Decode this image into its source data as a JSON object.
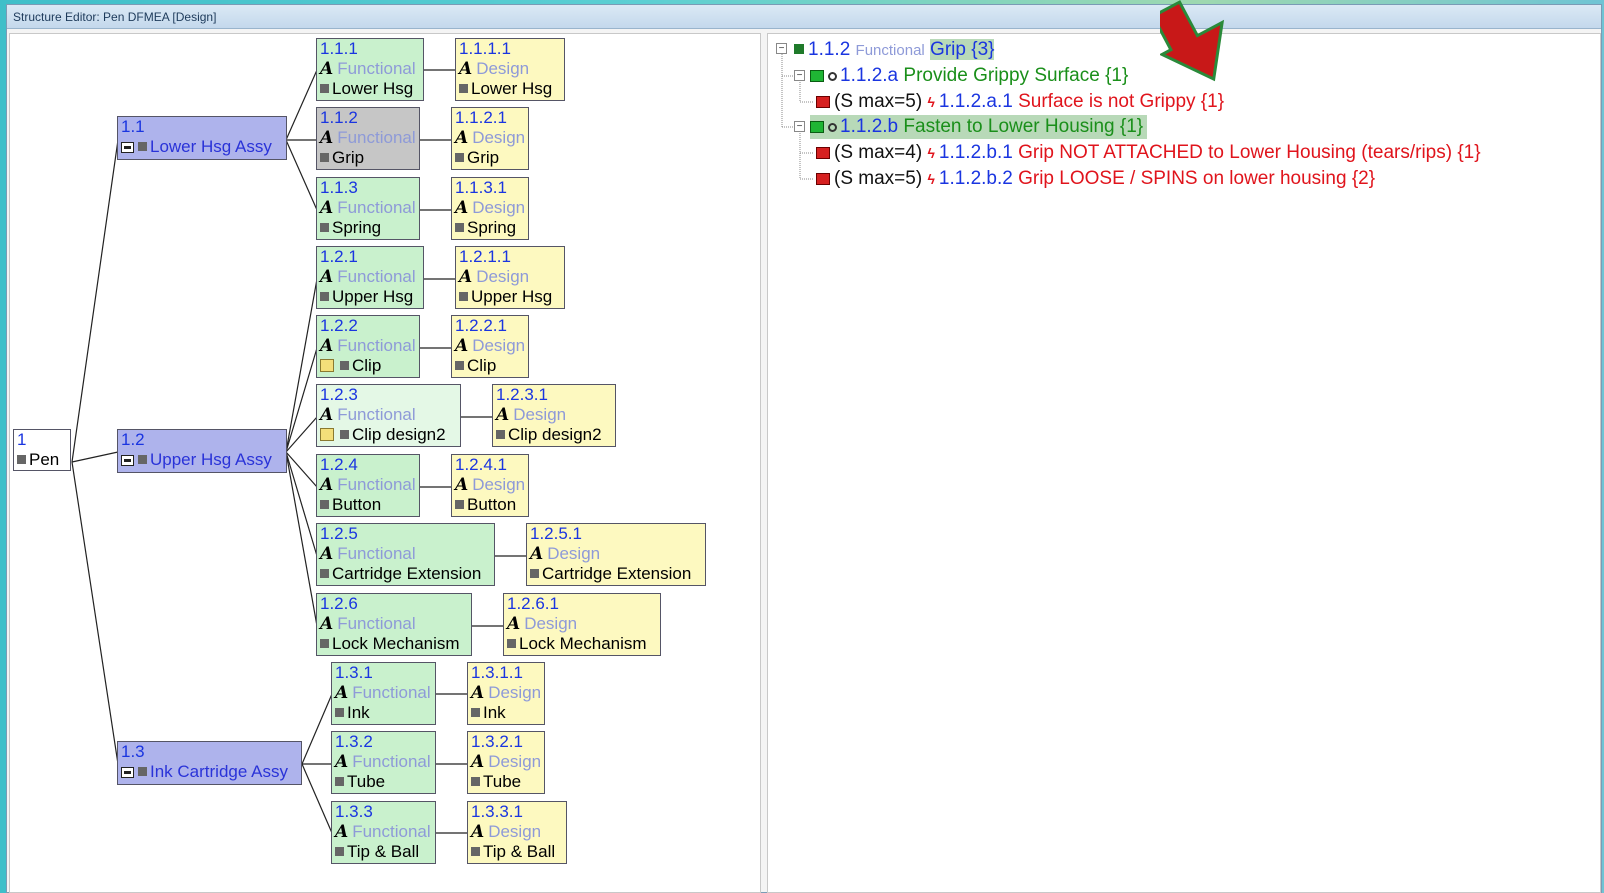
{
  "window": {
    "title": "Structure Editor: Pen DFMEA [Design]"
  },
  "left_tree": {
    "root": {
      "num": "1",
      "label": "Pen"
    },
    "assy": [
      {
        "num": "1.1",
        "label": "Lower Hsg Assy"
      },
      {
        "num": "1.2",
        "label": "Upper Hsg Assy"
      },
      {
        "num": "1.3",
        "label": "Ink Cartridge Assy"
      }
    ],
    "functional_kind": "Functional",
    "design_kind": "Design",
    "functional": [
      {
        "num": "1.1.1",
        "label": "Lower Hsg"
      },
      {
        "num": "1.1.2",
        "label": "Grip"
      },
      {
        "num": "1.1.3",
        "label": "Spring"
      },
      {
        "num": "1.2.1",
        "label": "Upper Hsg"
      },
      {
        "num": "1.2.2",
        "label": "Clip"
      },
      {
        "num": "1.2.3",
        "label": "Clip design2"
      },
      {
        "num": "1.2.4",
        "label": "Button"
      },
      {
        "num": "1.2.5",
        "label": "Cartridge Extension"
      },
      {
        "num": "1.2.6",
        "label": "Lock Mechanism"
      },
      {
        "num": "1.3.1",
        "label": "Ink"
      },
      {
        "num": "1.3.2",
        "label": "Tube"
      },
      {
        "num": "1.3.3",
        "label": "Tip & Ball"
      }
    ],
    "design": [
      {
        "num": "1.1.1.1",
        "label": "Lower Hsg"
      },
      {
        "num": "1.1.2.1",
        "label": "Grip"
      },
      {
        "num": "1.1.3.1",
        "label": "Spring"
      },
      {
        "num": "1.2.1.1",
        "label": "Upper Hsg"
      },
      {
        "num": "1.2.2.1",
        "label": "Clip"
      },
      {
        "num": "1.2.3.1",
        "label": "Clip design2"
      },
      {
        "num": "1.2.4.1",
        "label": "Button"
      },
      {
        "num": "1.2.5.1",
        "label": "Cartridge Extension"
      },
      {
        "num": "1.2.6.1",
        "label": "Lock Mechanism"
      },
      {
        "num": "1.3.1.1",
        "label": "Ink"
      },
      {
        "num": "1.3.2.1",
        "label": "Tube"
      },
      {
        "num": "1.3.3.1",
        "label": "Tip & Ball"
      }
    ]
  },
  "right_tree": {
    "root": {
      "num": "1.1.2",
      "kind": "Functional",
      "label": "Grip {3}"
    },
    "func_a": {
      "num": "1.1.2.a",
      "label": "Provide Grippy Surface {1}"
    },
    "fail_a1": {
      "sev": "(S max=5)",
      "num": "1.1.2.a.1",
      "label": "Surface is not Grippy {1}"
    },
    "func_b": {
      "num": "1.1.2.b",
      "label": "Fasten to Lower Housing {1}"
    },
    "fail_b1": {
      "sev": "(S max=4)",
      "num": "1.1.2.b.1",
      "label": "Grip NOT ATTACHED to Lower Housing (tears/rips) {1}"
    },
    "fail_b2": {
      "sev": "(S max=5)",
      "num": "1.1.2.b.2",
      "label": "Grip LOOSE / SPINS on lower housing {2}"
    }
  },
  "colors": {
    "functional": "#c9f1cd",
    "design": "#fdf9c0",
    "assy": "#aeb3ec",
    "accent_blue": "#1a35e0",
    "fail_red": "#e0141c",
    "func_green": "#1a8f1a",
    "arrow": "#c81818"
  }
}
